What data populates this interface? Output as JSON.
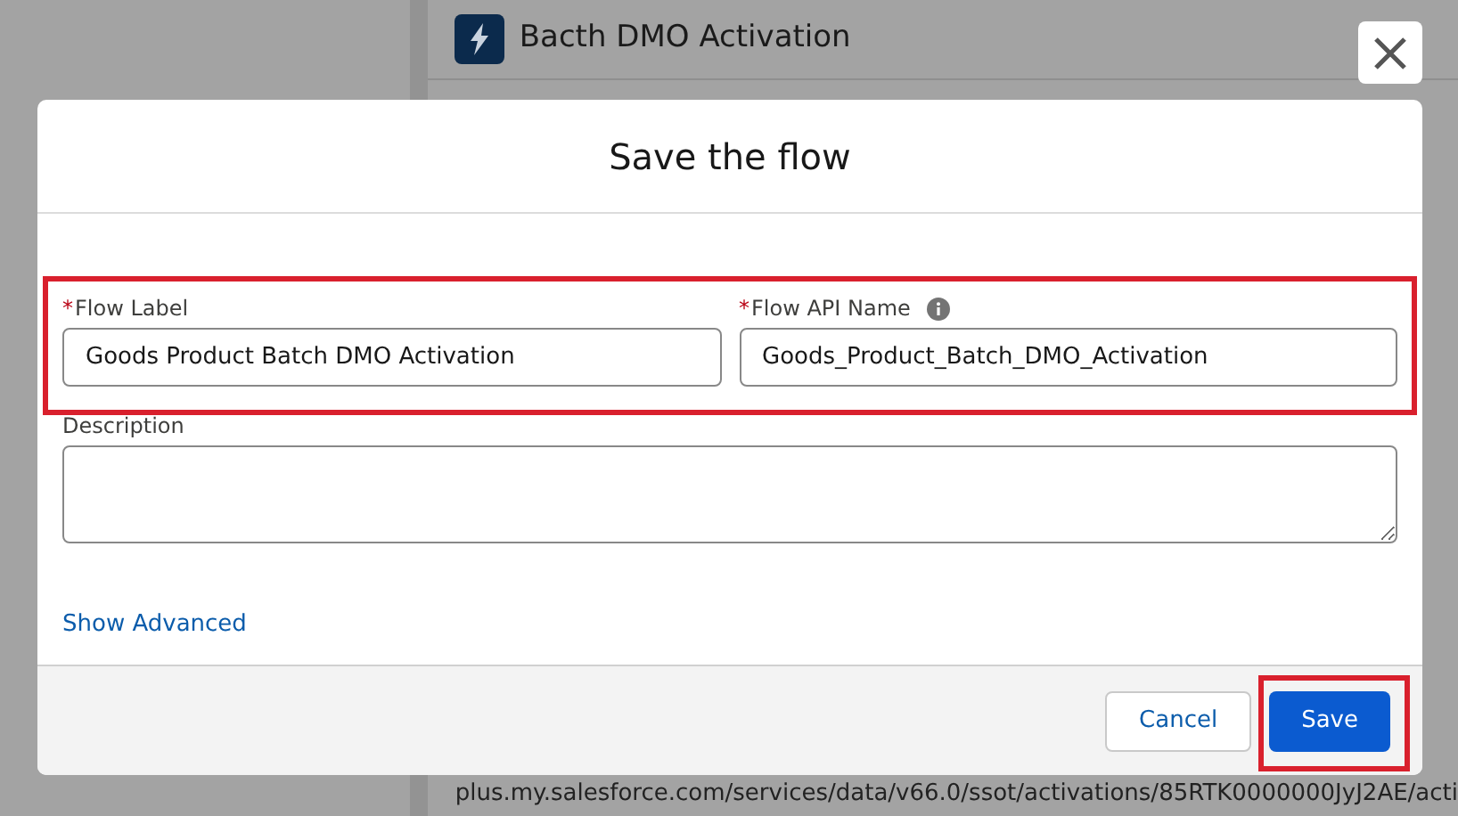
{
  "background": {
    "title": "Bacth DMO Activation",
    "url_text": "plus.my.salesforce.com/services/data/v66.0/ssot/activations/85RTK0000000JyJ2AE/acti"
  },
  "modal": {
    "title": "Save the flow",
    "fields": [
      {
        "marker": "*",
        "label": "Flow Label",
        "info": false,
        "value": "Goods Product Batch DMO Activation"
      },
      {
        "marker": "*",
        "label": "Flow API Name",
        "info": true,
        "value": "Goods_Product_Batch_DMO_Activation"
      }
    ],
    "description": {
      "label": "Description"
    },
    "link": "Show Advanced",
    "buttons": [
      {
        "label": "Cancel",
        "kind": "neutral"
      },
      {
        "label": "Save",
        "kind": "brand"
      }
    ]
  }
}
